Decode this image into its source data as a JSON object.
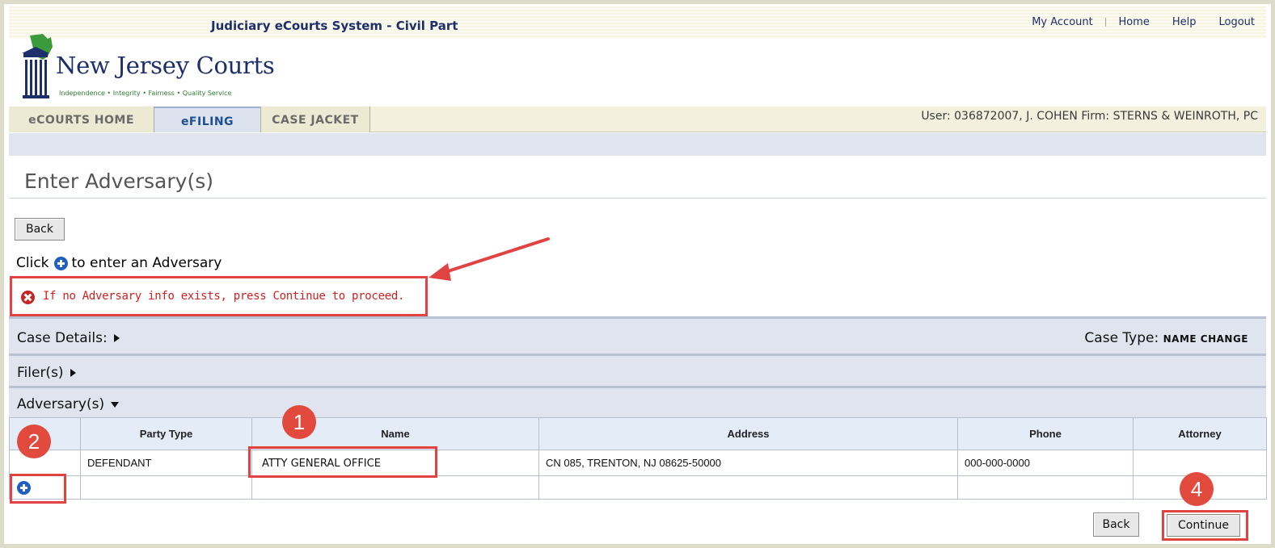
{
  "header": {
    "app_title": "Judiciary eCourts System - Civil Part",
    "links": [
      "My Account",
      "Home",
      "Help",
      "Logout"
    ],
    "logo_name": "New Jersey Courts",
    "logo_tagline": "Independence • Integrity • Fairness • Quality Service"
  },
  "tabs": [
    {
      "label": "eCOURTS HOME"
    },
    {
      "label": "eFILING"
    },
    {
      "label": "CASE JACKET"
    }
  ],
  "user_info": "User: 036872007, J. COHEN  Firm: STERNS & WEINROTH, PC",
  "page": {
    "title": "Enter Adversary(s)",
    "back_label": "Back",
    "instruction_before": "Click",
    "instruction_after": "to enter an Adversary",
    "error_message": "If no Adversary info exists, press Continue to proceed."
  },
  "sections": {
    "case_details": "Case Details:",
    "case_type_label": "Case Type:",
    "case_type_value": "NAME CHANGE",
    "filers": "Filer(s)",
    "adversaries": "Adversary(s)"
  },
  "table": {
    "headers": [
      "Party Type",
      "Name",
      "Address",
      "Phone",
      "Attorney"
    ],
    "rows": [
      {
        "party_type": "DEFENDANT",
        "name": "ATTY GENERAL OFFICE",
        "address": "CN 085, TRENTON, NJ 08625-50000",
        "phone": "000-000-0000",
        "attorney": ""
      }
    ]
  },
  "footer": {
    "back_label": "Back",
    "continue_label": "Continue"
  },
  "markers": [
    "1",
    "2",
    "4"
  ],
  "colors": {
    "brand_navy": "#1d2f6a",
    "annotation_red": "#e14242",
    "error_red": "#d21f1f",
    "section_bg": "#dfe4ee",
    "plus_blue": "#1f5fc4"
  }
}
